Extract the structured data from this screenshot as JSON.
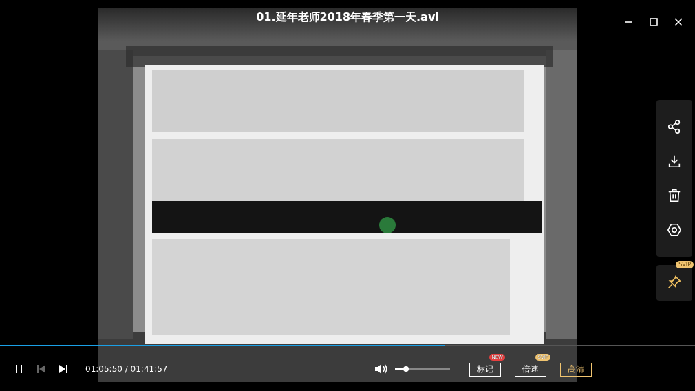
{
  "window": {
    "title": "01.延年老师2018年春季第一天.avi"
  },
  "progress": {
    "level": 0.64
  },
  "playback": {
    "playing": true,
    "time": "01:05:50 / 01:41:57"
  },
  "volume": {
    "muted": false,
    "level": 0.2
  },
  "buttons": [
    {
      "label": "标记",
      "badge": "NEW",
      "color": "#e84040",
      "selected": false
    },
    {
      "label": "倍速",
      "badge": "SVIP",
      "color": "#f0c470",
      "selected": false
    },
    {
      "label": "高清",
      "selected": true
    }
  ],
  "side_panel": {
    "pin_badge": "SVIP"
  }
}
